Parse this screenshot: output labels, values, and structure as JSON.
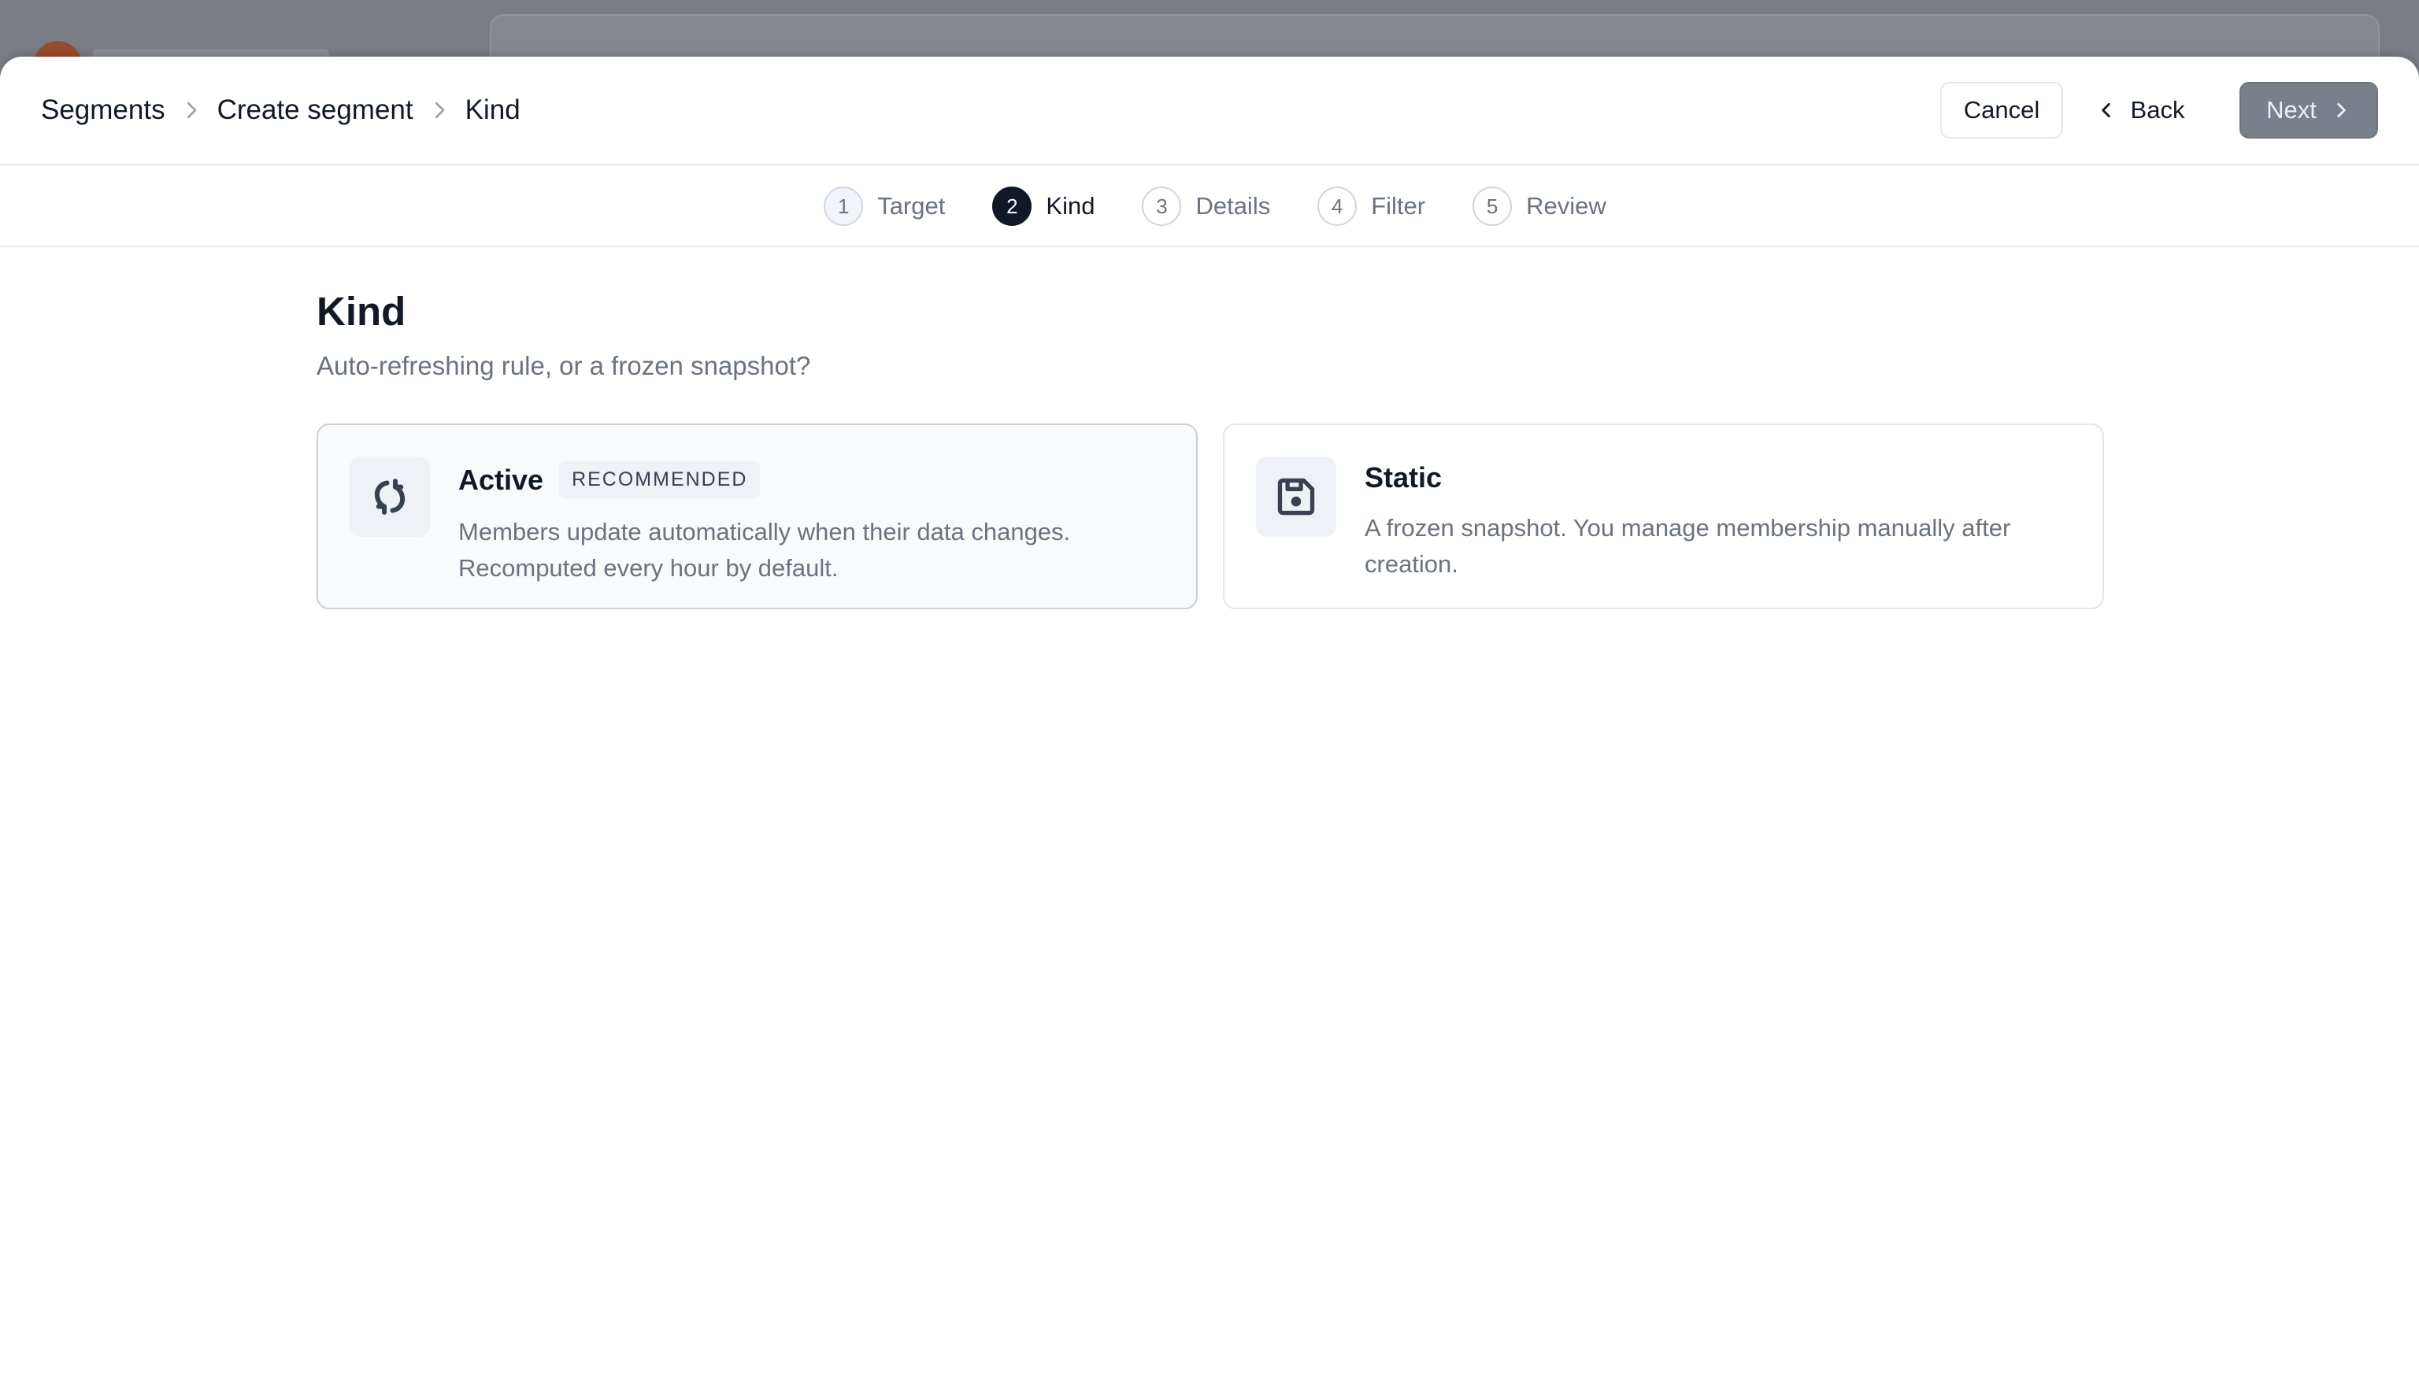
{
  "breadcrumb": {
    "items": [
      "Segments",
      "Create segment",
      "Kind"
    ]
  },
  "actions": {
    "cancel_label": "Cancel",
    "back_label": "Back",
    "next_label": "Next"
  },
  "stepper": {
    "steps": [
      {
        "number": "1",
        "label": "Target",
        "state": "completed"
      },
      {
        "number": "2",
        "label": "Kind",
        "state": "current"
      },
      {
        "number": "3",
        "label": "Details",
        "state": "upcoming"
      },
      {
        "number": "4",
        "label": "Filter",
        "state": "upcoming"
      },
      {
        "number": "5",
        "label": "Review",
        "state": "upcoming"
      }
    ]
  },
  "page": {
    "title": "Kind",
    "subtitle": "Auto-refreshing rule, or a frozen snapshot?"
  },
  "options": [
    {
      "title": "Active",
      "badge": "RECOMMENDED",
      "description_line1": "Members update automatically when their data changes.",
      "description_line2": "Recomputed every hour by default.",
      "icon": "refresh-icon",
      "selected": true
    },
    {
      "title": "Static",
      "description_line1": "A frozen snapshot. You manage membership manually after",
      "description_line2": "creation.",
      "icon": "save-icon",
      "selected": false
    }
  ],
  "colors": {
    "primary_dark": "#111827",
    "muted_text": "#6b7280",
    "border": "#e5e7eb",
    "next_button_disabled": "#797f8b"
  }
}
